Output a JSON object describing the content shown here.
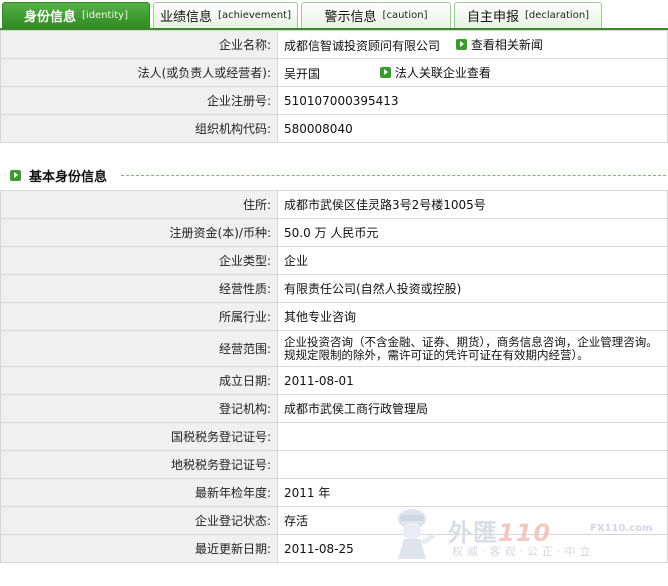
{
  "tabs": [
    {
      "label": "身份信息",
      "en": "[identity]"
    },
    {
      "label": "业绩信息",
      "en": "[achievement]"
    },
    {
      "label": "警示信息",
      "en": "[caution]"
    },
    {
      "label": "自主申报",
      "en": "[declaration]"
    }
  ],
  "top_table": {
    "company_name_label": "企业名称:",
    "company_name": "成都信智诚投资顾问有限公司",
    "news_link": "查看相关新闻",
    "legal_person_label": "法人(或负责人或经营者):",
    "legal_person": "吴开国",
    "legal_link": "法人关联企业查看",
    "reg_no_label": "企业注册号:",
    "reg_no": "510107000395413",
    "org_code_label": "组织机构代码:",
    "org_code": "580008040"
  },
  "section": {
    "title": "基本身份信息"
  },
  "basic_rows": [
    {
      "label": "住所:",
      "value": "成都市武侯区佳灵路3号2号楼1005号"
    },
    {
      "label": "注册资金(本)/币种:",
      "value": "50.0  万 人民币元"
    },
    {
      "label": "企业类型:",
      "value": "企业"
    },
    {
      "label": "经营性质:",
      "value": "有限责任公司(自然人投资或控股)"
    },
    {
      "label": "所属行业:",
      "value": "其他专业咨询"
    },
    {
      "label": "经营范围:",
      "value": "企业投资咨询（不含金融、证券、期货），商务信息咨询，企业管理咨询。规规定限制的除外，需许可证的凭许可证在有效期内经营）。"
    },
    {
      "label": "成立日期:",
      "value": "2011-08-01"
    },
    {
      "label": "登记机构:",
      "value": "成都市武侯工商行政管理局"
    },
    {
      "label": "国税税务登记证号:",
      "value": ""
    },
    {
      "label": "地税税务登记证号:",
      "value": ""
    },
    {
      "label": "最新年检年度:",
      "value": "2011 年"
    },
    {
      "label": "企业登记状态:",
      "value": "存活"
    },
    {
      "label": "最近更新日期:",
      "value": "2011-08-25"
    }
  ],
  "watermark": {
    "brand": "外匯",
    "brand_num": "110",
    "url": "FX110.com",
    "slogan": "权威·客观·公正·中立"
  },
  "colors": {
    "accent": "#3c9b2e",
    "label_bg": "#f0f0f0",
    "border": "#d7d7d7"
  }
}
